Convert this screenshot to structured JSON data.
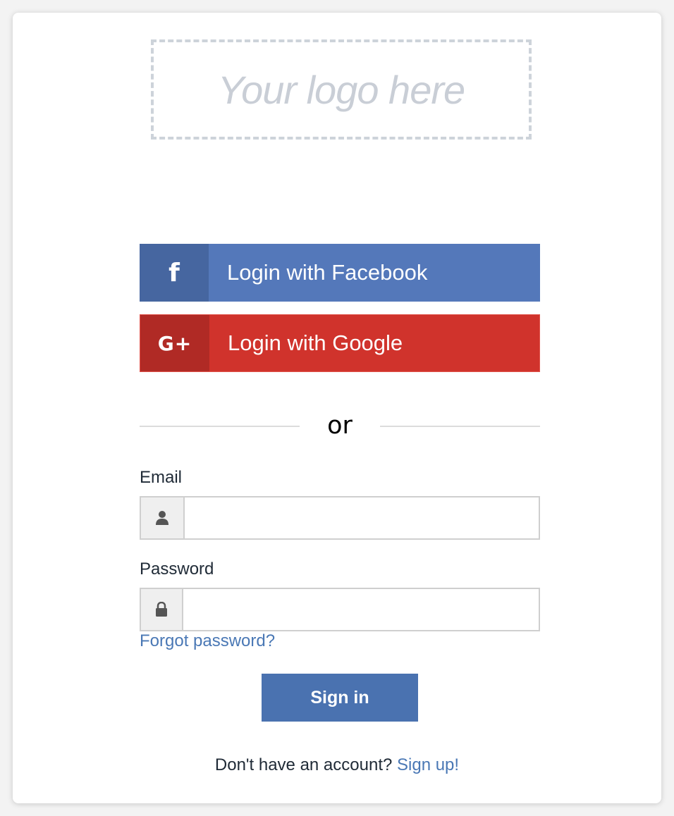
{
  "logo": {
    "placeholder_text": "Your logo here"
  },
  "social": {
    "facebook": {
      "icon": "f",
      "icon_name": "facebook-icon",
      "label": "Login with Facebook",
      "color": "#5478ba"
    },
    "google": {
      "icon": "G+",
      "icon_name": "google-plus-icon",
      "label": "Login with Google",
      "color": "#d0332c"
    }
  },
  "divider": {
    "text": "or"
  },
  "form": {
    "email": {
      "label": "Email",
      "icon_name": "user-icon",
      "value": ""
    },
    "password": {
      "label": "Password",
      "icon_name": "lock-icon",
      "value": ""
    },
    "forgot_label": "Forgot password?",
    "submit_label": "Sign in",
    "submit_color": "#4a72b0"
  },
  "footer": {
    "prompt": "Don't have an account? ",
    "signup_label": "Sign up!",
    "link_color": "#4a78b5"
  }
}
